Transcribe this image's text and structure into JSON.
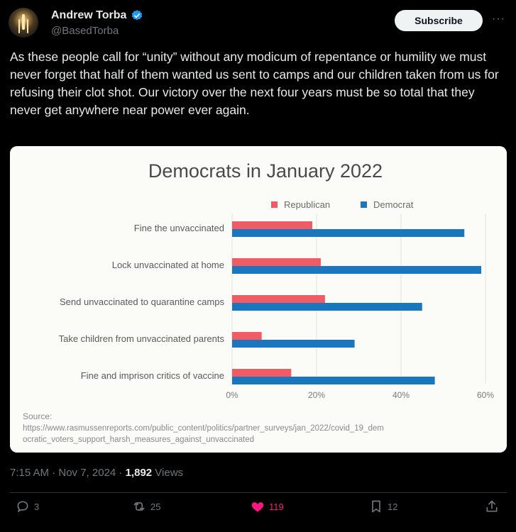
{
  "author": {
    "display_name": "Andrew Torba",
    "handle": "@BasedTorba"
  },
  "header": {
    "subscribe_label": "Subscribe",
    "more_label": "···"
  },
  "tweet": {
    "text": "As these people call for “unity” without any modicum of repentance or humility we must never forget that half of them wanted us sent to camps and our children taken from us for refusing their clot shot. Our victory over the next four years must be so total that they never get anywhere near power ever again.",
    "time": "7:15 AM · Nov 7, 2024 · ",
    "views_count": "1,892",
    "views_label": " Views"
  },
  "actions": {
    "replies": "3",
    "reposts": "25",
    "likes": "119",
    "bookmarks": "12"
  },
  "colors": {
    "republican": "#f15b64",
    "democrat": "#1a76bf",
    "like": "#f91880"
  },
  "chart_data": {
    "type": "bar",
    "orientation": "horizontal",
    "title": "Democrats in January 2022",
    "categories": [
      "Fine the unvaccinated",
      "Lock unvaccinated at home",
      "Send unvaccinated to quarantine camps",
      "Take children from unvaccinated parents",
      "Fine and imprison critics of vaccine"
    ],
    "series": [
      {
        "name": "Republican",
        "values": [
          19,
          21,
          22,
          7,
          14
        ]
      },
      {
        "name": "Democrat",
        "values": [
          55,
          59,
          45,
          29,
          48
        ]
      }
    ],
    "xlim": [
      0,
      60
    ],
    "xticks": [
      "0%",
      "20%",
      "40%",
      "60%"
    ],
    "grid": true,
    "legend": "top-right",
    "source_label": "Source:",
    "source_url_line1": "https://www.rasmussenreports.com/public_content/politics/partner_surveys/jan_2022/covid_19_dem",
    "source_url_line2": "ocratic_voters_support_harsh_measures_against_unvaccinated"
  }
}
